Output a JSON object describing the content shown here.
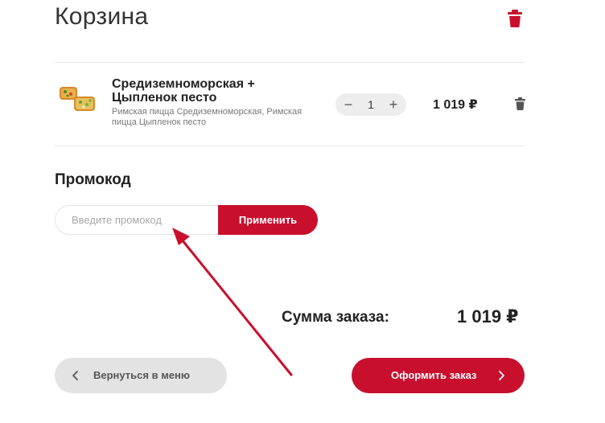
{
  "cart": {
    "title": "Корзина",
    "items": [
      {
        "name": "Средиземноморская + Цыпленок песто",
        "description": "Римская пицца Средиземноморская, Римская пицца Цыпленок песто",
        "quantity": "1",
        "minus": "−",
        "plus": "+",
        "price": "1 019 ₽"
      }
    ]
  },
  "promo": {
    "title": "Промокод",
    "placeholder": "Введите промокод",
    "apply_label": "Применить"
  },
  "summary": {
    "label": "Сумма заказа:",
    "total": "1 019 ₽"
  },
  "actions": {
    "back_label": "Вернуться в меню",
    "order_label": "Оформить заказ"
  },
  "colors": {
    "accent": "#c8102e",
    "annotation_arrow": "#c8102e",
    "secondary_button": "#e3e3e3"
  },
  "icons": {
    "clear_cart": "trash-icon",
    "remove_item": "trash-icon",
    "back": "chevron-left-icon",
    "order": "chevron-right-icon"
  }
}
